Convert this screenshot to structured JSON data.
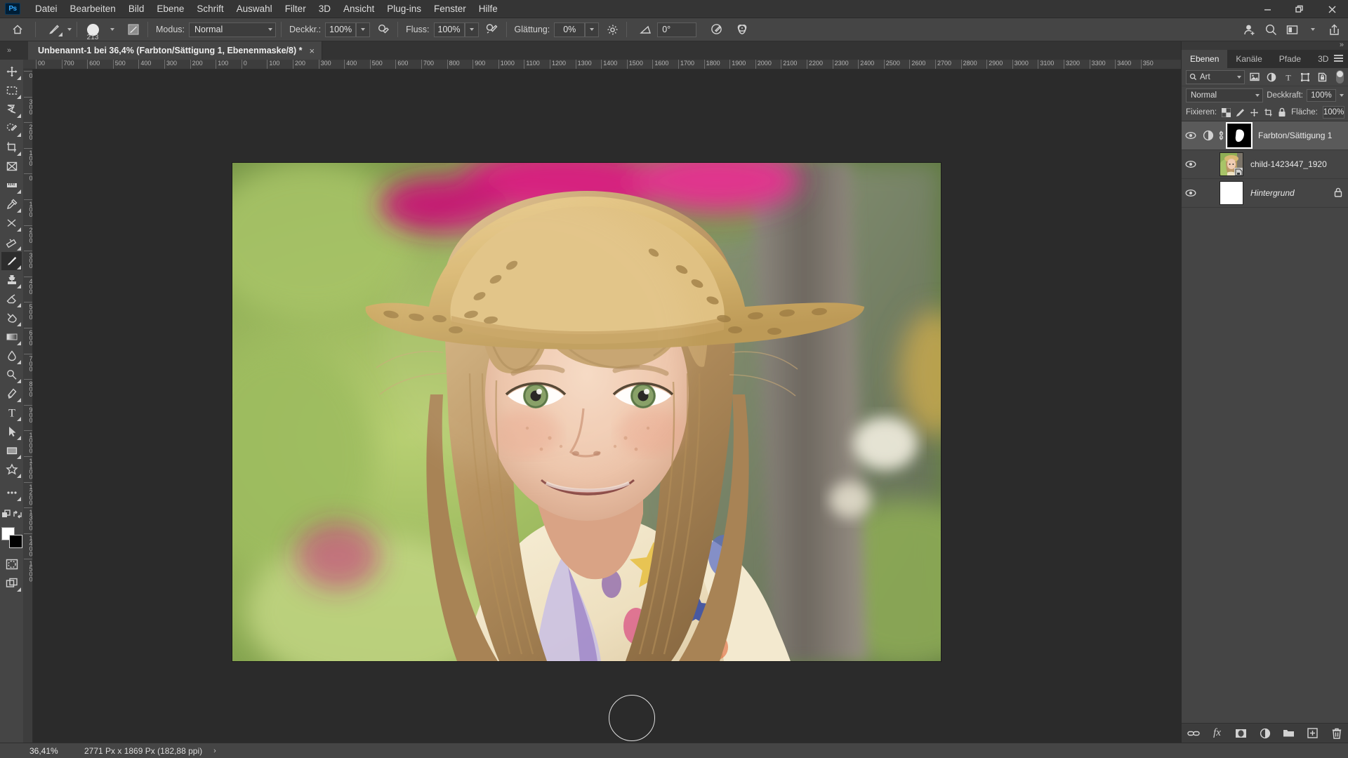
{
  "app": {
    "logo": "Ps",
    "menus": [
      "Datei",
      "Bearbeiten",
      "Bild",
      "Ebene",
      "Schrift",
      "Auswahl",
      "Filter",
      "3D",
      "Ansicht",
      "Plug-ins",
      "Fenster",
      "Hilfe"
    ],
    "window_controls": {
      "minimize": "minimize-icon",
      "maximize": "maximize-icon",
      "close": "close-icon"
    }
  },
  "options_bar": {
    "tool_icon": "brush-tool-icon",
    "home_icon": "home-icon",
    "brush_size": "213",
    "brush_panel_icon": "brush-settings-icon",
    "mode_label": "Modus:",
    "mode_value": "Normal",
    "opacity_label": "Deckkr.:",
    "opacity_value": "100%",
    "opacity_pressure_icon": "pressure-opacity-icon",
    "flow_label": "Fluss:",
    "flow_value": "100%",
    "airbrush_icon": "airbrush-icon",
    "smoothing_label": "Glättung:",
    "smoothing_value": "0%",
    "smoothing_gear_icon": "gear-icon",
    "angle_icon": "angle-icon",
    "angle_value": "0°",
    "pressure_size_icon": "pressure-size-icon",
    "symmetry_icon": "symmetry-butterfly-icon"
  },
  "options_bar_right": {
    "icons": [
      "share-user-icon",
      "search-icon",
      "workspace-icon",
      "chevron-down-icon",
      "export-icon"
    ]
  },
  "document_tab": {
    "title": "Unbenannt-1 bei 36,4% (Farbton/Sättigung 1, Ebenenmaske/8) *",
    "close_glyph": "×",
    "collapse_glyph": "»"
  },
  "toolbar": {
    "tools": [
      {
        "name": "move-tool",
        "icon": "move-icon",
        "active": false,
        "has_flyout": true
      },
      {
        "name": "marquee-tool",
        "icon": "rectangular-marquee-icon",
        "active": false,
        "has_flyout": true
      },
      {
        "name": "lasso-tool",
        "icon": "lasso-icon",
        "active": false,
        "has_flyout": true
      },
      {
        "name": "quick-selection-tool",
        "icon": "quick-selection-icon",
        "active": false,
        "has_flyout": true
      },
      {
        "name": "crop-tool",
        "icon": "crop-icon",
        "active": false,
        "has_flyout": true
      },
      {
        "name": "frame-tool",
        "icon": "frame-icon",
        "active": false,
        "has_flyout": false
      },
      {
        "name": "ruler-tool",
        "icon": "ruler-icon",
        "active": false,
        "has_flyout": true
      },
      {
        "name": "eyedropper-tool",
        "icon": "eyedropper-icon",
        "active": false,
        "has_flyout": true
      },
      {
        "name": "healing-brush-tool",
        "icon": "spot-healing-icon",
        "active": false,
        "has_flyout": true
      },
      {
        "name": "eraser-shape-tool",
        "icon": "patch-icon",
        "active": false,
        "has_flyout": true
      },
      {
        "name": "brush-tool",
        "icon": "brush-icon",
        "active": true,
        "has_flyout": true
      },
      {
        "name": "clone-stamp-tool",
        "icon": "clone-stamp-icon",
        "active": false,
        "has_flyout": true
      },
      {
        "name": "eraser-tool",
        "icon": "eraser-icon",
        "active": false,
        "has_flyout": true
      },
      {
        "name": "gradient-tool",
        "icon": "paint-bucket-icon",
        "active": false,
        "has_flyout": true
      },
      {
        "name": "gradient-fill-tool",
        "icon": "gradient-icon",
        "active": false,
        "has_flyout": true
      },
      {
        "name": "blur-tool",
        "icon": "blur-drop-icon",
        "active": false,
        "has_flyout": true
      },
      {
        "name": "dodge-tool",
        "icon": "dodge-icon",
        "active": false,
        "has_flyout": true
      },
      {
        "name": "pen-tool",
        "icon": "pen-icon",
        "active": false,
        "has_flyout": true
      },
      {
        "name": "type-tool",
        "icon": "type-icon",
        "active": false,
        "has_flyout": true
      },
      {
        "name": "path-selection-tool",
        "icon": "path-selection-arrow-icon",
        "active": false,
        "has_flyout": true
      },
      {
        "name": "rectangle-tool",
        "icon": "rectangle-shape-icon",
        "active": false,
        "has_flyout": true
      },
      {
        "name": "custom-shape-tool",
        "icon": "custom-shape-star-icon",
        "active": false,
        "has_flyout": true
      },
      {
        "name": "more-tools",
        "icon": "ellipsis-icon",
        "active": false,
        "has_flyout": true
      },
      {
        "name": "edit-toolbar",
        "icon": "edit-toolbar-icon",
        "active": false,
        "has_flyout": false
      },
      {
        "name": "swap-colors",
        "icon": "swap-arrows-icon",
        "active": false,
        "has_flyout": false
      }
    ],
    "foreground_color": "#ffffff",
    "background_color": "#000000",
    "quickmask_icon": "quick-mask-icon",
    "screenmode_icon": "screen-mode-icon"
  },
  "rulers": {
    "horizontal_ticks": [
      "00",
      "700",
      "600",
      "500",
      "400",
      "300",
      "200",
      "100",
      "0",
      "100",
      "200",
      "300",
      "400",
      "500",
      "600",
      "700",
      "800",
      "900",
      "1000",
      "1100",
      "1200",
      "1300",
      "1400",
      "1500",
      "1600",
      "1700",
      "1800",
      "1900",
      "2000",
      "2100",
      "2200",
      "2300",
      "2400",
      "2500",
      "2600",
      "2700",
      "2800",
      "2900",
      "3000",
      "3100",
      "3200",
      "3300",
      "3400",
      "350"
    ],
    "vertical_ticks": [
      "0",
      "300",
      "200",
      "100",
      "0",
      "100",
      "200",
      "300",
      "400",
      "500",
      "600",
      "700",
      "800",
      "900",
      "1000",
      "1100",
      "1200",
      "1300",
      "1400",
      "1500"
    ]
  },
  "panels": {
    "tabs": [
      {
        "label": "Ebenen",
        "active": true
      },
      {
        "label": "Kanäle",
        "active": false
      },
      {
        "label": "Pfade",
        "active": false
      },
      {
        "label": "3D",
        "active": false
      }
    ],
    "menu_icon": "panel-menu-icon",
    "filter": {
      "search_icon": "search-icon",
      "kind_label": "Art",
      "filter_icons": [
        "filter-pixel-icon",
        "filter-adjustment-icon",
        "filter-type-icon",
        "filter-shape-icon",
        "filter-smart-object-icon"
      ],
      "toggle_icon": "filter-toggle-switch"
    },
    "blend": {
      "mode_value": "Normal",
      "opacity_label": "Deckkraft:",
      "opacity_value": "100%"
    },
    "lock": {
      "label": "Fixieren:",
      "icons": [
        "lock-transparent-pixels-icon",
        "lock-image-pixels-icon",
        "lock-position-icon",
        "lock-artboard-icon",
        "lock-all-icon"
      ],
      "fill_label": "Fläche:",
      "fill_value": "100%"
    },
    "layers": [
      {
        "name": "Farbton/Sättigung 1",
        "visible": true,
        "selected": true,
        "type": "adjustment",
        "has_adjustment_icon": true,
        "has_link_icon": true,
        "has_mask": true,
        "italic": false,
        "locked": false
      },
      {
        "name": "child-1423447_1920",
        "visible": true,
        "selected": false,
        "type": "smart-object",
        "has_adjustment_icon": false,
        "has_link_icon": false,
        "has_mask": false,
        "italic": false,
        "locked": false
      },
      {
        "name": "Hintergrund",
        "visible": true,
        "selected": false,
        "type": "background",
        "has_adjustment_icon": false,
        "has_link_icon": false,
        "has_mask": false,
        "italic": true,
        "locked": true
      }
    ],
    "footer_icons": [
      "link-layers-icon",
      "layer-style-fx-icon",
      "add-layer-mask-icon",
      "new-adjustment-layer-icon",
      "new-group-icon",
      "new-layer-icon",
      "delete-layer-icon"
    ],
    "footer_fx_label": "fx"
  },
  "status_bar": {
    "zoom": "36,41%",
    "doc_size": "2771 Px x 1869 Px (182,88 ppi)",
    "arrow_glyph": "›"
  },
  "colors": {
    "ui_background": "#393939",
    "panel_background": "#454545",
    "canvas_background": "#2b2b2b",
    "accent": "#31a8ff",
    "selected_layer": "#5a5a5a"
  }
}
